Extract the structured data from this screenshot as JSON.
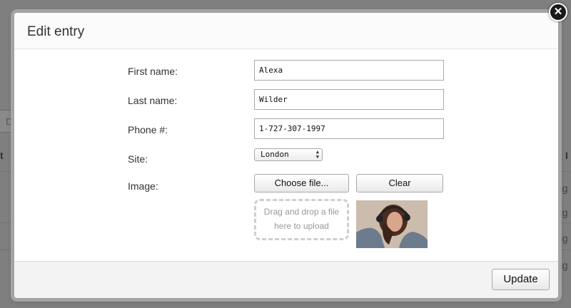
{
  "background": {
    "search_partial": "D",
    "col_left_partial": "t",
    "col_right_partial": "I",
    "row_cells_partial": [
      "ag",
      "ag",
      "ag",
      "ag"
    ]
  },
  "modal": {
    "title": "Edit entry",
    "close_icon": "close-icon",
    "fields": {
      "first_name": {
        "label": "First name:",
        "value": "Alexa"
      },
      "last_name": {
        "label": "Last name:",
        "value": "Wilder"
      },
      "phone": {
        "label": "Phone #:",
        "value": "1-727-307-1997"
      },
      "site": {
        "label": "Site:",
        "value": "London"
      },
      "image": {
        "label": "Image:",
        "choose_label": "Choose file...",
        "clear_label": "Clear",
        "dropzone_line1": "Drag and drop a file",
        "dropzone_line2": "here to upload"
      }
    },
    "update_label": "Update"
  }
}
